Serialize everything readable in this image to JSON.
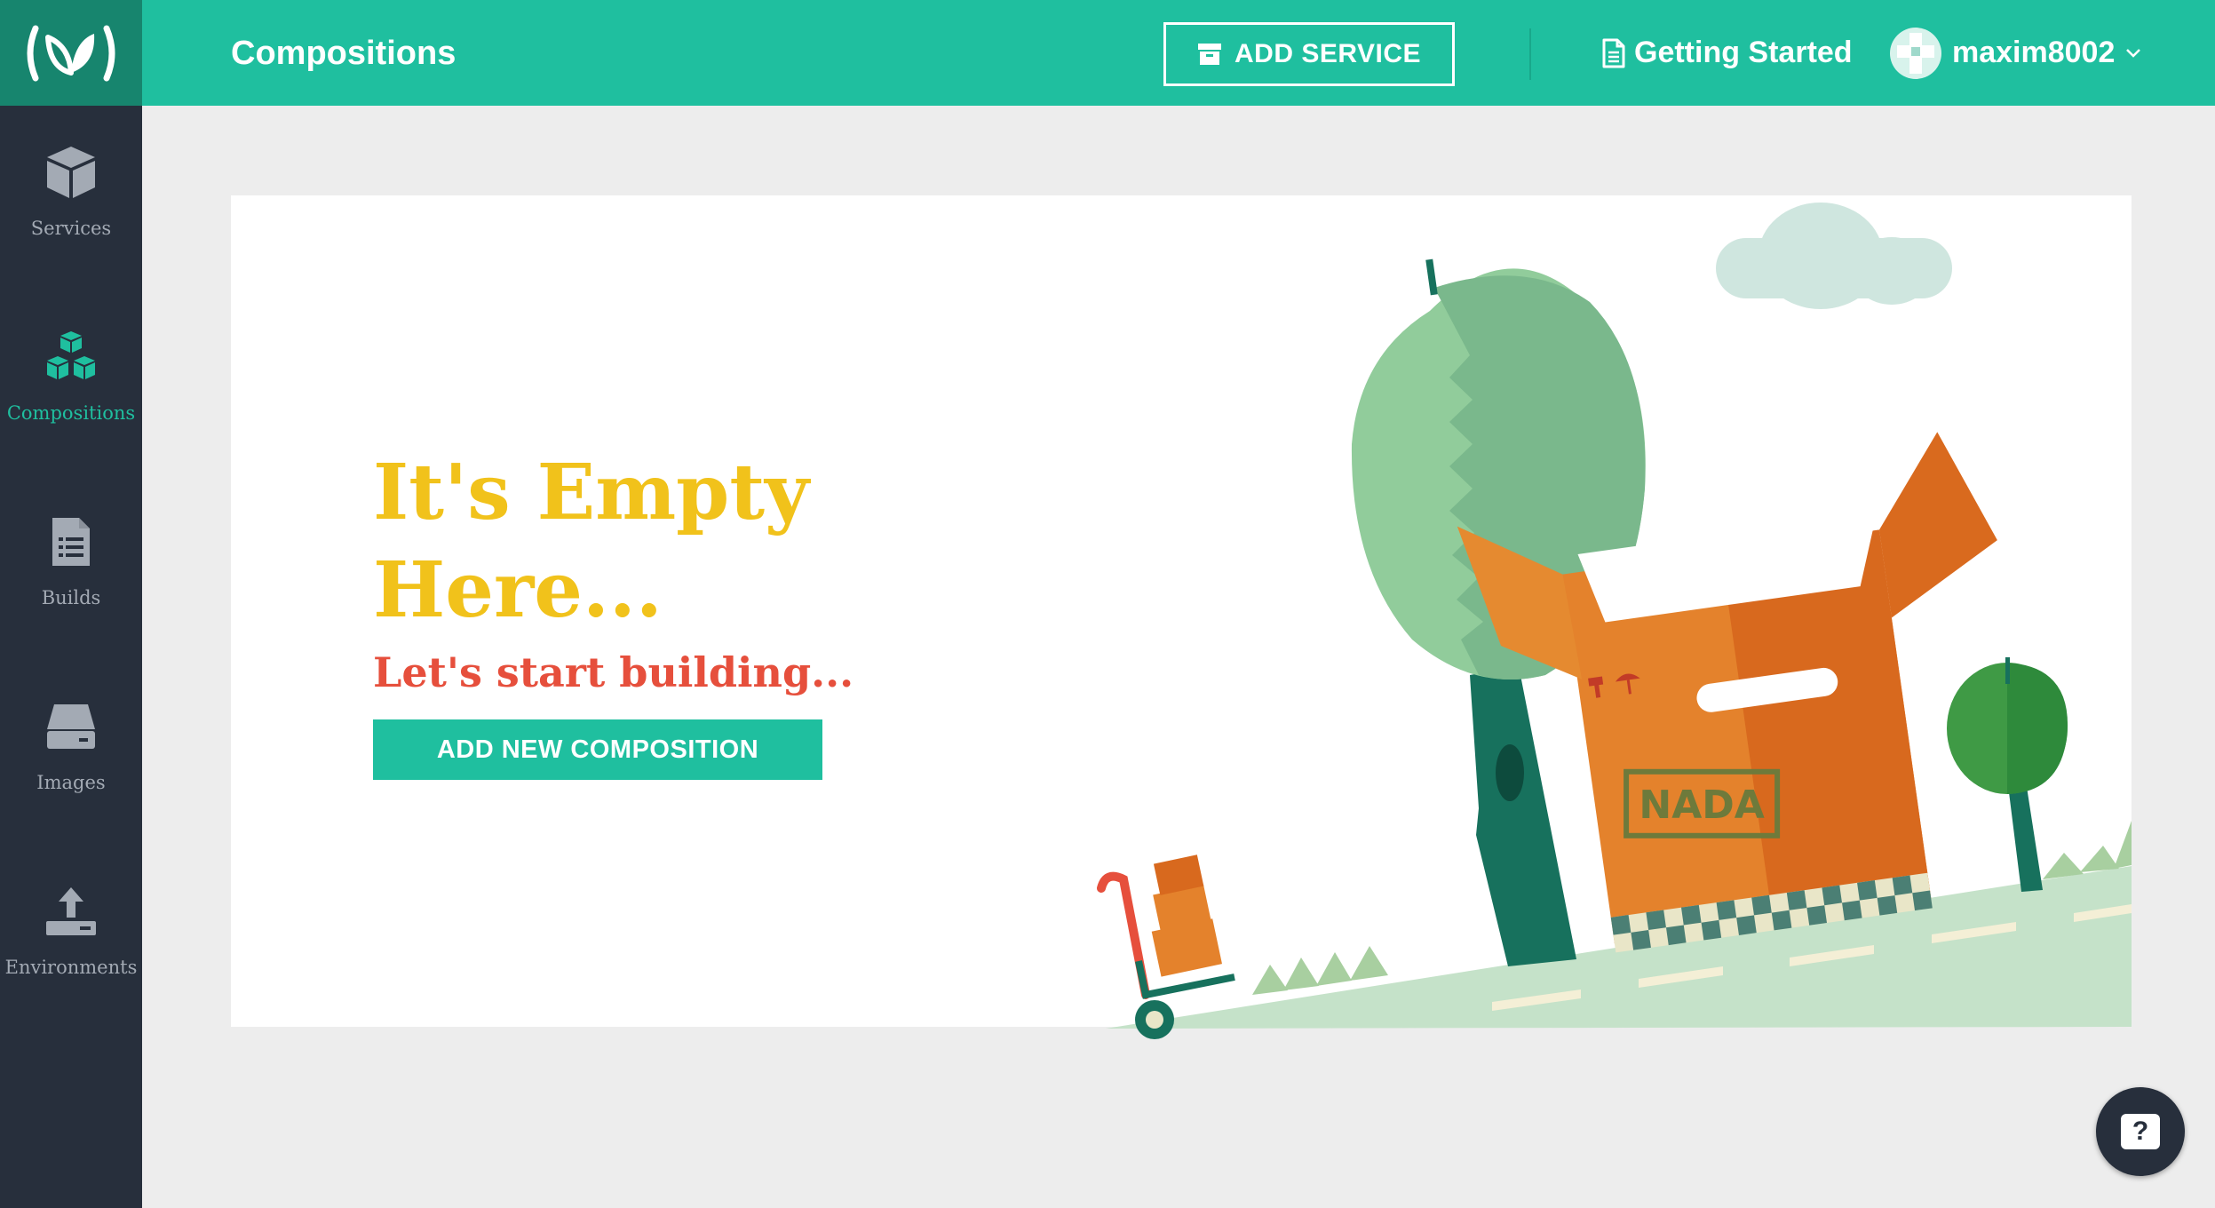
{
  "header": {
    "title": "Compositions",
    "add_service_label": "ADD SERVICE",
    "getting_started_label": "Getting Started",
    "username": "maxim8002"
  },
  "sidebar": {
    "items": [
      {
        "label": "Services",
        "icon": "cube-icon",
        "active": false
      },
      {
        "label": "Compositions",
        "icon": "cubes-icon",
        "active": true
      },
      {
        "label": "Builds",
        "icon": "document-list-icon",
        "active": false
      },
      {
        "label": "Images",
        "icon": "hard-drive-icon",
        "active": false
      },
      {
        "label": "Environments",
        "icon": "upload-icon",
        "active": false
      }
    ]
  },
  "empty_state": {
    "title": "It's Empty Here...",
    "subtitle": "Let's start building...",
    "button_label": "ADD NEW COMPOSITION",
    "stamp_text": "NADA"
  },
  "help": {
    "label": "?"
  },
  "colors": {
    "brand": "#1fbf9f",
    "brand_dark": "#17856e",
    "sidebar": "#272f3c",
    "title_yellow": "#f1c21b",
    "subtitle_red": "#e64f3c"
  }
}
